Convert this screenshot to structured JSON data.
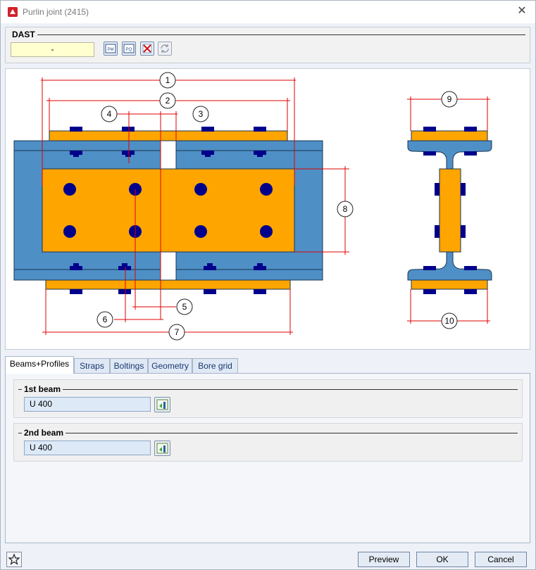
{
  "window": {
    "title": "Purlin joint (2415)"
  },
  "dast": {
    "title": "DAST",
    "value": "-"
  },
  "toolbar": {
    "buttons": [
      {
        "name": "pm-button",
        "icon": "pm-icon",
        "text": "PM"
      },
      {
        "name": "pq-button",
        "icon": "pq-icon",
        "text": "PQ"
      },
      {
        "name": "delete-button",
        "icon": "delete-icon",
        "text": ""
      },
      {
        "name": "refresh-button",
        "icon": "refresh-icon",
        "text": ""
      }
    ]
  },
  "drawing": {
    "labels": [
      "1",
      "2",
      "3",
      "4",
      "5",
      "6",
      "7",
      "8",
      "9",
      "10"
    ],
    "colors": {
      "beam": "#4e8fc6",
      "strap": "#ffa500",
      "bolt": "#00008b",
      "dimension": "#e00000"
    }
  },
  "tabs": [
    "Beams+Profiles",
    "Straps",
    "Boltings",
    "Geometry",
    "Bore grid"
  ],
  "active_tab": "Beams+Profiles",
  "beams": [
    {
      "title": "1st beam",
      "value": "U 400"
    },
    {
      "title": "2nd beam",
      "value": "U 400"
    }
  ],
  "footer": {
    "preview": "Preview",
    "ok": "OK",
    "cancel": "Cancel"
  }
}
